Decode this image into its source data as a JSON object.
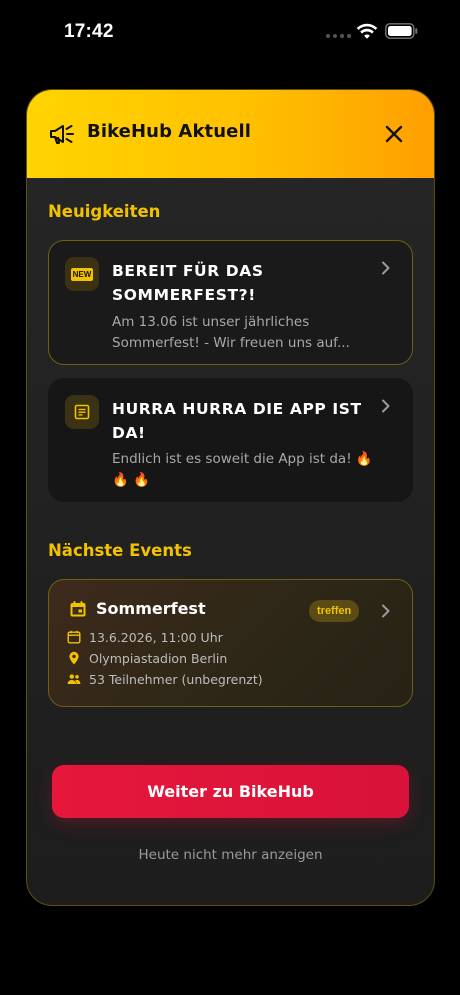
{
  "status_bar": {
    "time": "17:42",
    "icons": [
      "signal-dots-icon",
      "wifi-icon",
      "battery-icon"
    ]
  },
  "modal": {
    "title": "BikeHub Aktuell",
    "header_icon": "megaphone-icon",
    "close_icon": "close-icon",
    "colors": {
      "header_start": "#ffd400",
      "header_end": "#ff9f00",
      "accent": "#f2c200",
      "primary_button": "#e6173b"
    }
  },
  "news": {
    "section_title": "Neuigkeiten",
    "items": [
      {
        "icon": "new-badge-icon",
        "badge_text": "NEW",
        "title": "BEREIT FÜR DAS SOMMERFEST?!",
        "text": "Am 13.06 ist unser jährliches Sommerfest! - Wir freuen uns auf..."
      },
      {
        "icon": "article-icon",
        "title": "HURRA HURRA DIE APP IST DA!",
        "text": "Endlich ist es soweit die App ist da! 🔥 🔥 🔥"
      }
    ]
  },
  "events": {
    "section_title": "Nächste Events",
    "items": [
      {
        "title": "Sommerfest",
        "badge": "treffen",
        "date": "13.6.2026, 11:00 Uhr",
        "location": "Olympiastadion Berlin",
        "participants": "53 Teilnehmer (unbegrenzt)"
      }
    ]
  },
  "actions": {
    "primary_label": "Weiter zu BikeHub",
    "dismiss_label": "Heute nicht mehr anzeigen"
  }
}
